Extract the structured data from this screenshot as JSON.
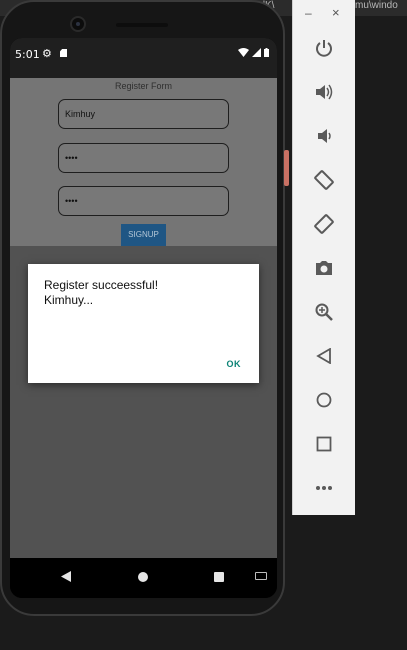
{
  "host_window": {
    "path_fragment_1": "\\SdK\\",
    "path_fragment_2": "mu\\windo"
  },
  "status_bar": {
    "time": "5:01"
  },
  "register_form": {
    "title": "Register Form",
    "username_value": "Kimhuy",
    "password_value": "••••",
    "confirm_value": "••••",
    "signup_label": "SIGNUP"
  },
  "dialog": {
    "message": "Register succeessful!\nKimhuy...",
    "ok_label": "OK"
  },
  "emulator_toolbar": {
    "minimize_label": "–",
    "close_label": "×",
    "buttons": [
      "power-icon",
      "volume-up-icon",
      "volume-down-icon",
      "rotate-left-icon",
      "rotate-right-icon",
      "screenshot-icon",
      "zoom-icon",
      "back-icon",
      "home-icon",
      "overview-icon",
      "more-icon"
    ]
  },
  "colors": {
    "signup_button": "#1f5684",
    "ok_text": "#0c8376",
    "toolbar_icon": "#5a5a5a"
  }
}
